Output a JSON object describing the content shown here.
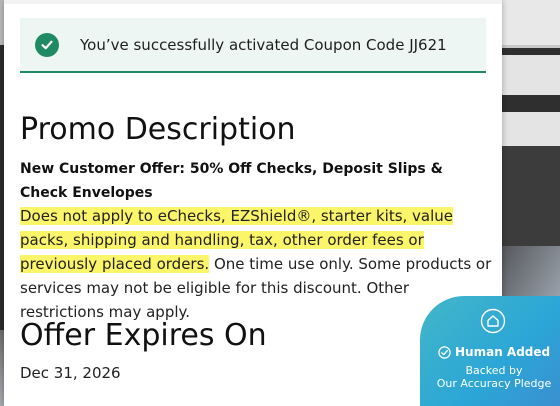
{
  "alert": {
    "message": "You’ve successfully activated Coupon Code JJ621",
    "icon": "check-circle-icon",
    "color": "#1f8a64"
  },
  "promo": {
    "title": "Promo Description",
    "offer": "New Customer Offer: 50% Off Checks, Deposit Slips & Check Envelopes",
    "highlighted": "Does not apply to eChecks, EZShield®, starter kits, value packs, shipping and handling, tax, other order fees or previously placed orders.",
    "rest": " One time use only. Some products or services may not be eligible for this discount. Other restrictions may apply.",
    "highlight_color": "#fbf56a"
  },
  "expiry": {
    "title": "Offer Expires On",
    "date": "Dec 31, 2026"
  },
  "badge": {
    "title": "Human Added",
    "line1": "Backed by",
    "line2": "Our Accuracy Pledge",
    "icon": "home-shield-icon"
  }
}
